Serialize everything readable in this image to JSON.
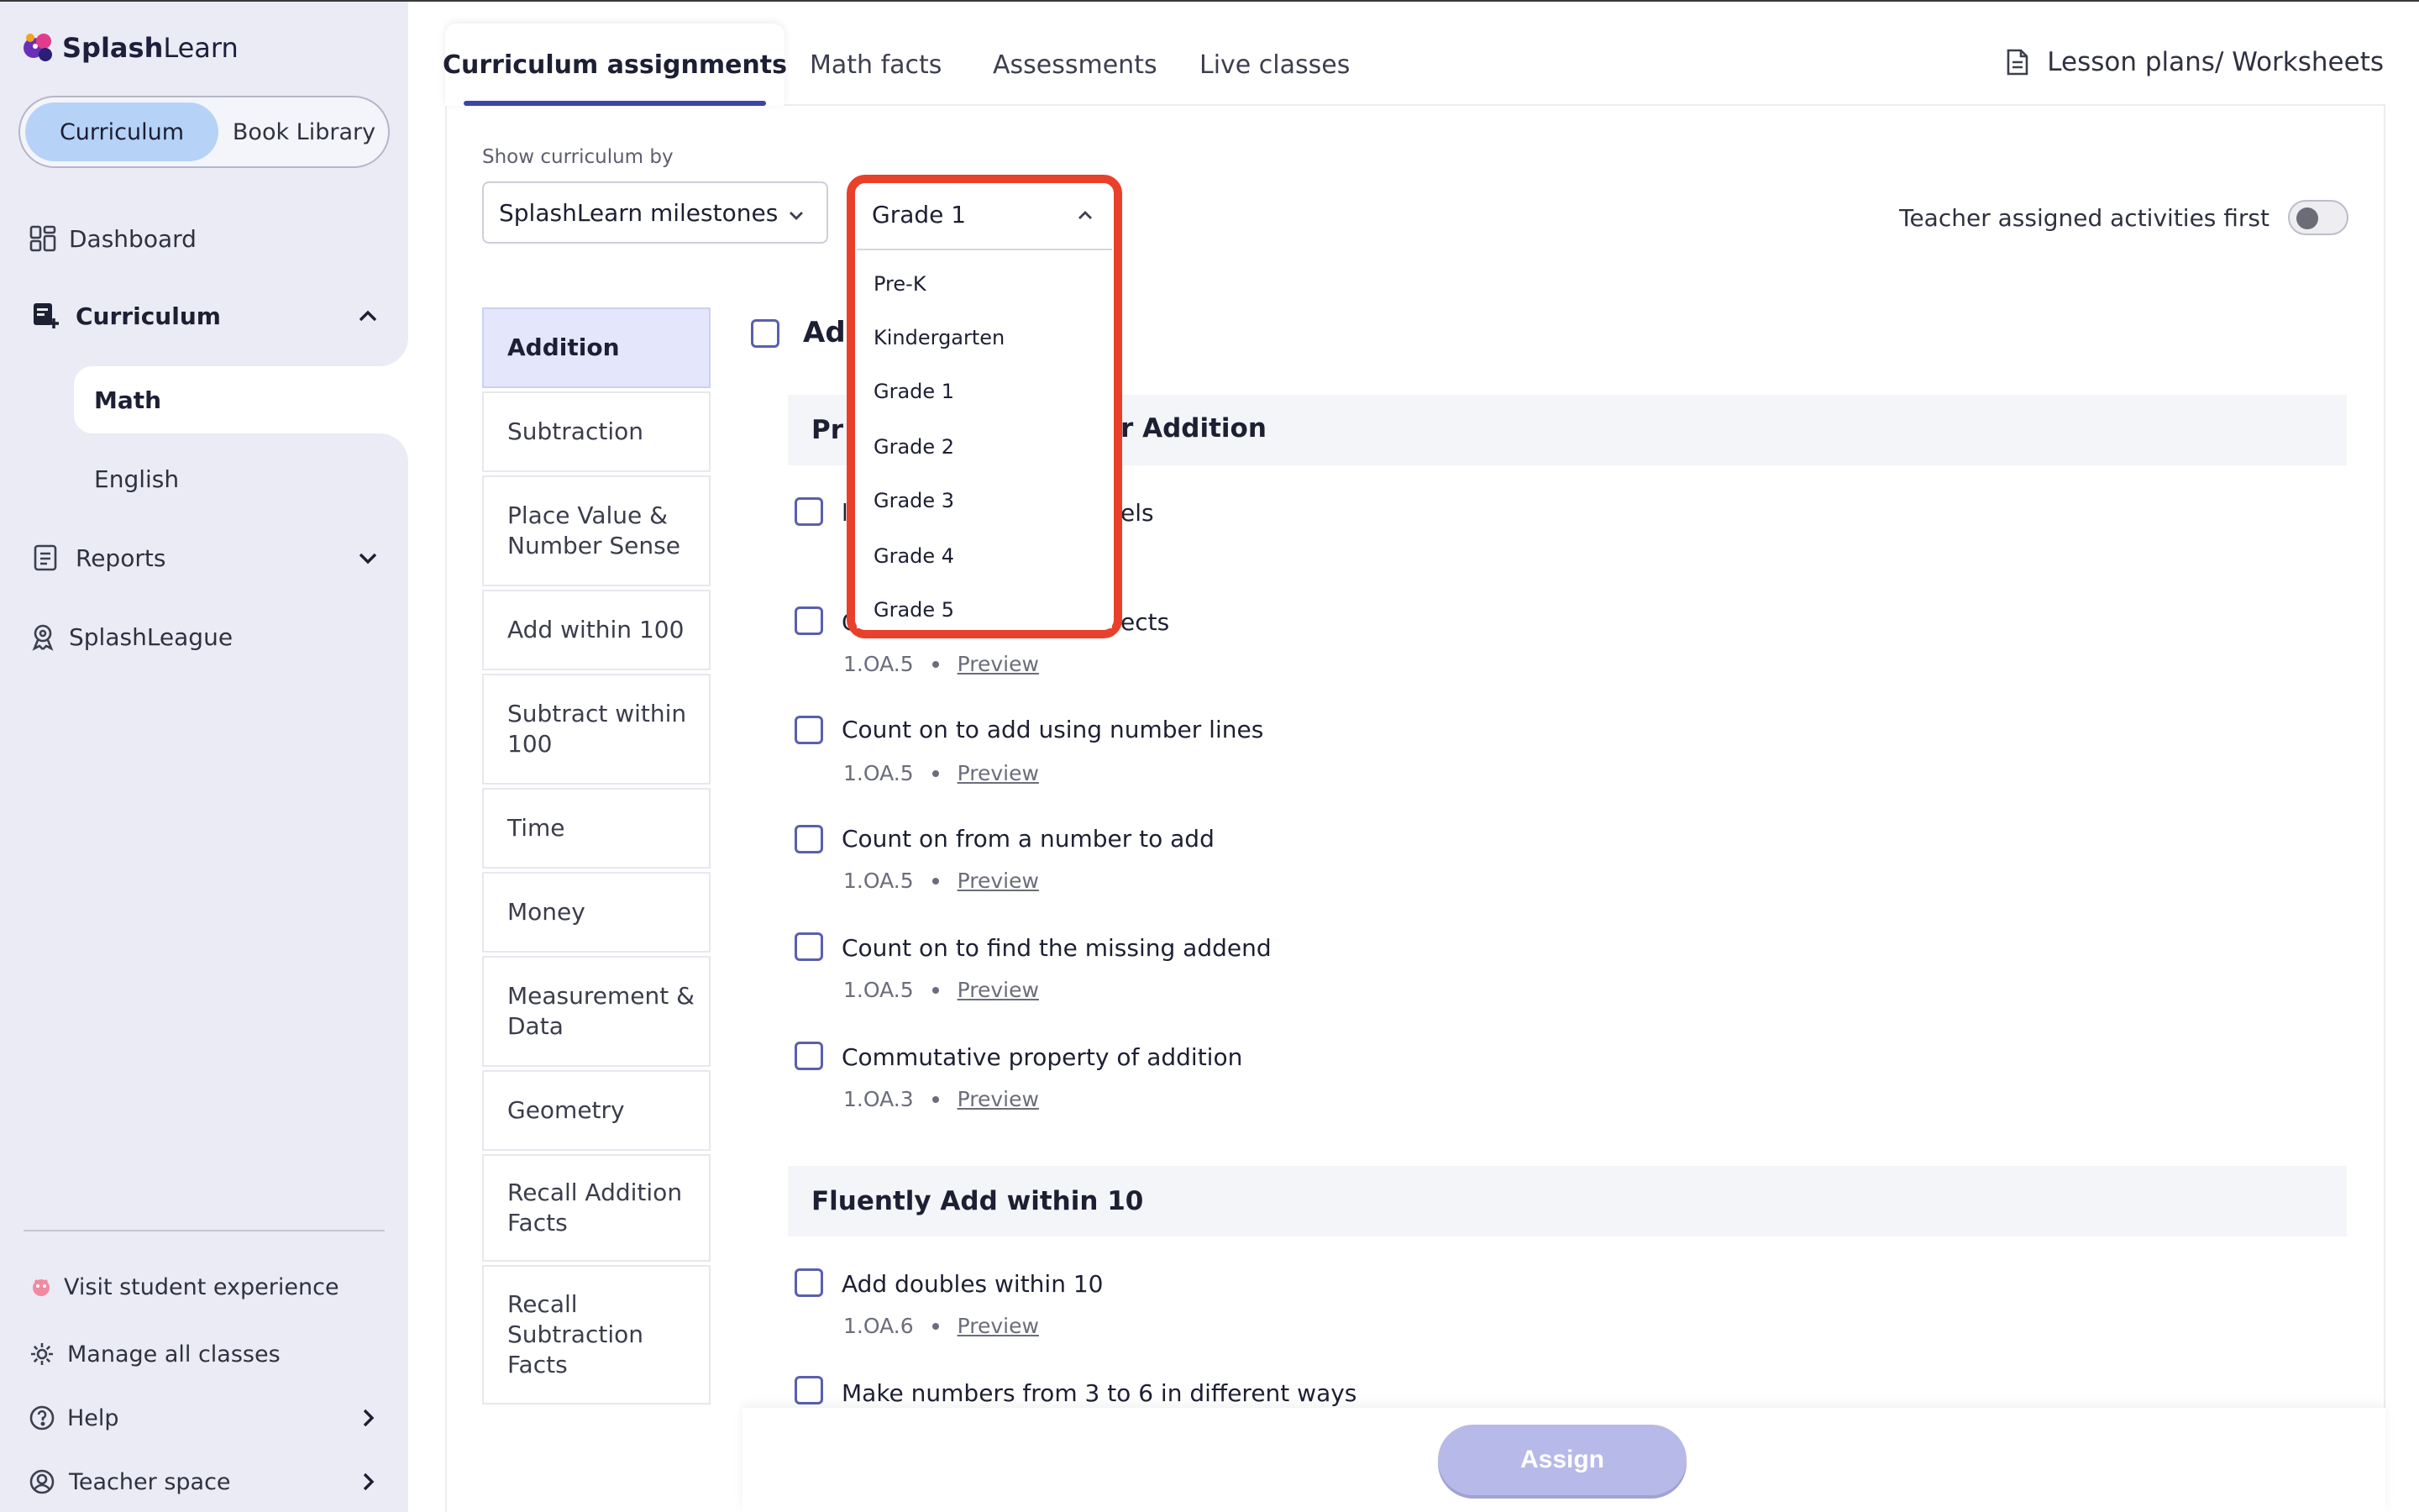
{
  "brand": {
    "name_bold": "Splash",
    "name_regular": "Learn"
  },
  "sidebar": {
    "library_toggle": {
      "active": "Curriculum",
      "inactive": "Book Library"
    },
    "nav": {
      "dashboard": "Dashboard",
      "curriculum": "Curriculum",
      "math": "Math",
      "english": "English",
      "reports": "Reports",
      "splashleague": "SplashLeague"
    },
    "footer": {
      "visit_student": "Visit student experience",
      "manage_classes": "Manage all classes",
      "help": "Help",
      "teacher_space": "Teacher space"
    }
  },
  "header": {
    "tabs": [
      "Curriculum assignments",
      "Math facts",
      "Assessments",
      "Live classes"
    ],
    "lesson_link": "Lesson plans/ Worksheets"
  },
  "filters": {
    "show_by_label": "Show curriculum by",
    "milestones_value": "SplashLearn milestones",
    "grade_value": "Grade 1",
    "grade_options": [
      "Pre-K",
      "Kindergarten",
      "Grade 1",
      "Grade 2",
      "Grade 3",
      "Grade 4",
      "Grade 5"
    ],
    "teacher_first_label": "Teacher assigned activities first",
    "teacher_first_on": false
  },
  "topics": [
    "Addition",
    "Subtraction",
    "Place Value & Number Sense",
    "Add within 100",
    "Subtract within 100",
    "Time",
    "Money",
    "Measurement & Data",
    "Geometry",
    "Recall Addition Facts",
    "Recall Subtraction Facts"
  ],
  "content": {
    "topic_title_partial": "Ad",
    "section1_partial_left": "Pr",
    "section1_partial_right": "r Addition",
    "item1_partial": "els",
    "item1_left": "l",
    "item2_partial": "ects",
    "item2_left": "C",
    "section2": "Fluently Add within 10",
    "items": [
      {
        "title": "",
        "code": "1.OA.5",
        "preview": "Preview"
      },
      {
        "title": "Count on to add using number lines",
        "code": "1.OA.5",
        "preview": "Preview"
      },
      {
        "title": "Count on from a number to add",
        "code": "1.OA.5",
        "preview": "Preview"
      },
      {
        "title": "Count on to find the missing addend",
        "code": "1.OA.5",
        "preview": "Preview"
      },
      {
        "title": "Commutative property of addition",
        "code": "1.OA.3",
        "preview": "Preview"
      },
      {
        "title": "Add doubles within 10",
        "code": "1.OA.6",
        "preview": "Preview"
      },
      {
        "title": "Make numbers from 3 to 6 in different ways",
        "code": "",
        "preview": ""
      }
    ]
  },
  "actions": {
    "assign": "Assign"
  },
  "colors": {
    "accent": "#3b44a8",
    "highlight_frame": "#e8402b",
    "sidebar_bg": "#eaebf5",
    "toggle_active": "#b6d2f7",
    "assign_disabled": "#b7b9e8"
  }
}
